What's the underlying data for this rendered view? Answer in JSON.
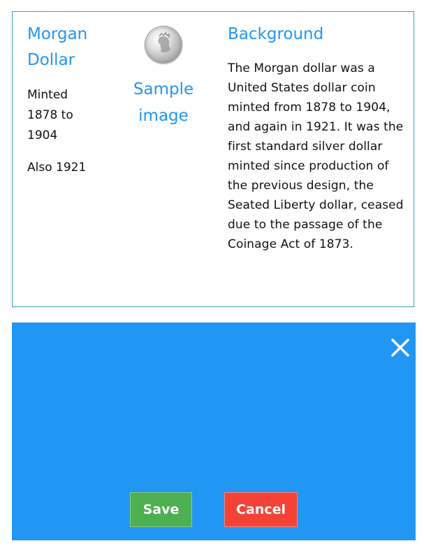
{
  "card": {
    "title": "Morgan Dollar",
    "minted": "Minted 1878 to 1904",
    "also": "Also 1921",
    "image_caption": "Sample image",
    "image_icon": "coin-icon",
    "background_heading": "Background",
    "background_text": "The Morgan dollar was a United States dollar coin minted from 1878 to 1904, and again in 1921. It was the first standard silver dollar minted since production of the previous design, the Seated Liberty dollar, ceased due to the passage of the Coinage Act of 1873."
  },
  "modal": {
    "close_icon": "close-icon",
    "save_label": "Save",
    "cancel_label": "Cancel"
  },
  "colors": {
    "accent": "#2196f3",
    "save": "#4caf50",
    "cancel": "#f44336",
    "card_border": "#3aa0c9"
  }
}
